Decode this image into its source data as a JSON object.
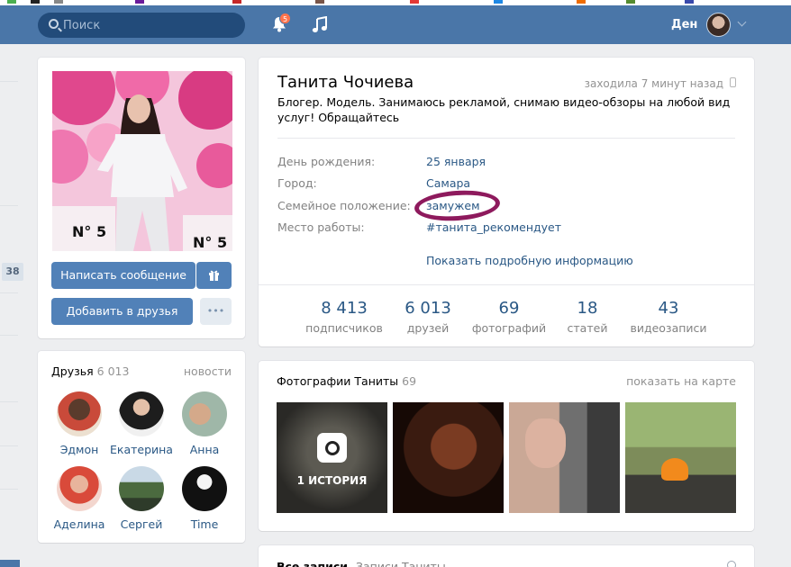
{
  "header": {
    "search_placeholder": "Поиск",
    "notifications_count": "5",
    "user_name": "Ден"
  },
  "sidebar": {
    "counter": "38"
  },
  "profile_actions": {
    "message_button": "Написать сообщение",
    "add_friend_button": "Добавить в друзья",
    "more_button": "•••"
  },
  "profile": {
    "name": "Танита Чочиева",
    "last_seen": "заходила 7 минут назад",
    "status": "Блогер. Модель. Занимаюсь рекламой, снимаю видео-обзоры на любой вид услуг! Обращайтесь",
    "info": [
      {
        "label": "День рождения:",
        "value": "25 января"
      },
      {
        "label": "Город:",
        "value": "Самара"
      },
      {
        "label": "Семейное положение:",
        "value": "замужем"
      },
      {
        "label": "Место работы:",
        "value": "#танита_рекомендует"
      }
    ],
    "show_more": "Показать подробную информацию",
    "counters": [
      {
        "num": "8 413",
        "label": "подписчиков"
      },
      {
        "num": "6 013",
        "label": "друзей"
      },
      {
        "num": "69",
        "label": "фотографий"
      },
      {
        "num": "18",
        "label": "статей"
      },
      {
        "num": "43",
        "label": "видеозаписи"
      }
    ]
  },
  "friends": {
    "title": "Друзья",
    "count": "6 013",
    "link": "новости",
    "items": [
      {
        "name": "Эдмон"
      },
      {
        "name": "Екатерина"
      },
      {
        "name": "Анна"
      },
      {
        "name": "Аделина"
      },
      {
        "name": "Сергей"
      },
      {
        "name": "Time"
      }
    ]
  },
  "photos": {
    "title": "Фотографии Таниты",
    "count": "69",
    "map_link": "показать на карте",
    "story_label": "1 ИСТОРИЯ"
  },
  "wall": {
    "tab_all": "Все записи",
    "tab_own": "Записи Таниты"
  },
  "colors": {
    "header": "#4a76a8",
    "link": "#2a5885",
    "button": "#5181b8",
    "highlight_marker": "#8e1a5d"
  }
}
